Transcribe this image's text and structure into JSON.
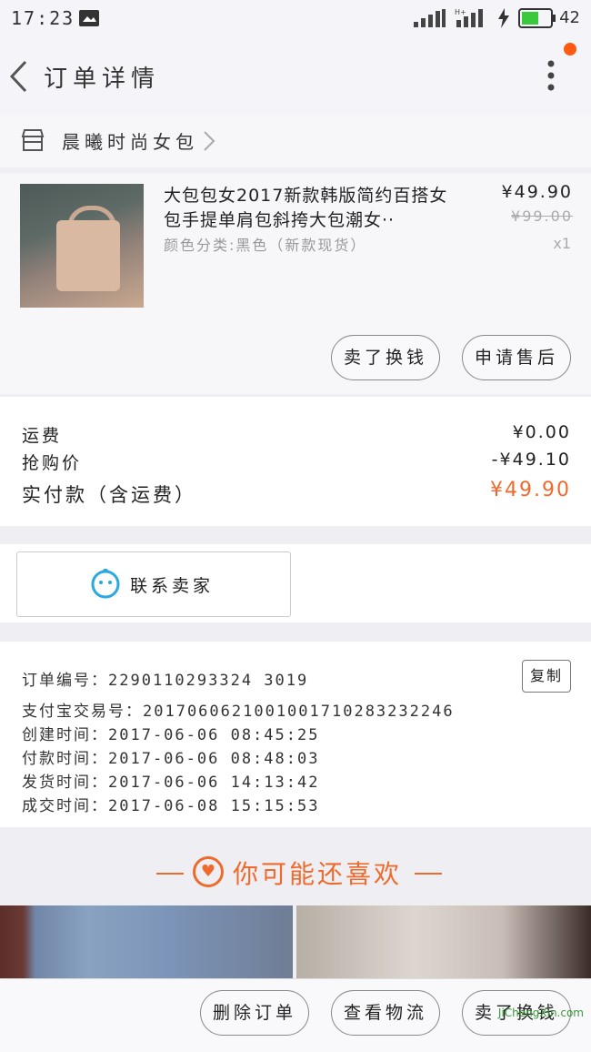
{
  "status_bar": {
    "time": "17:23",
    "battery": "42"
  },
  "nav": {
    "title": "订单详情"
  },
  "shop": {
    "name": "晨曦时尚女包"
  },
  "product": {
    "title": "大包包女2017新款韩版简约百搭女包手提单肩包斜挎大包潮女··",
    "spec": "颜色分类:黑色（新款现货）",
    "price": "¥49.90",
    "original_price": "¥99.00",
    "quantity": "x1",
    "buttons": {
      "resell": "卖了换钱",
      "after_sale": "申请售后"
    }
  },
  "fees": {
    "shipping_label": "运费",
    "shipping_value": "¥0.00",
    "discount_label": "抢购价",
    "discount_value": "-¥49.10",
    "total_label": "实付款（含运费）",
    "total_value": "¥49.90"
  },
  "contact": {
    "label": "联系卖家"
  },
  "order_info": {
    "order_no": "订单编号：2290110293324 3019",
    "alipay_no": "支付宝交易号：2017060621001001710283232246",
    "created": "创建时间：2017-06-06 08:45:25",
    "paid": "付款时间：2017-06-06 08:48:03",
    "shipped": "发货时间：2017-06-06 14:13:42",
    "completed": "成交时间：2017-06-08 15:15:53",
    "copy_label": "复制"
  },
  "recommend": {
    "title": "你可能还喜欢"
  },
  "bottom_bar": {
    "delete": "删除订单",
    "logistics": "查看物流",
    "resell": "卖了换钱"
  },
  "watermark": "JiChengXin.com",
  "colors": {
    "accent": "#ee6b2d",
    "badge": "#ff5a12",
    "contact_icon": "#29a9e0"
  }
}
